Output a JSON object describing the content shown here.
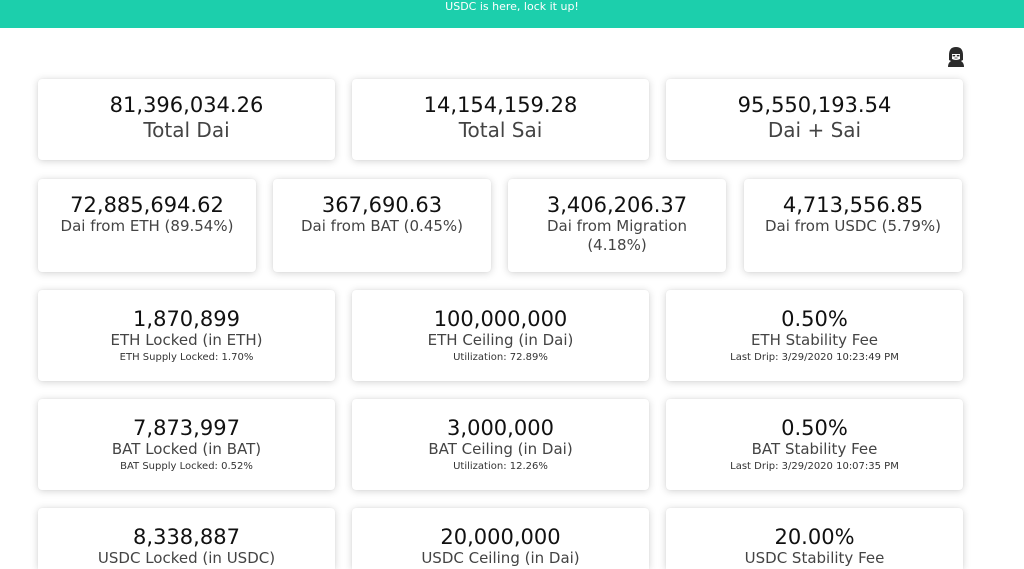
{
  "banner": {
    "text": "USDC is here, lock it up!"
  },
  "totals": [
    {
      "value": "81,396,034.26",
      "label": "Total Dai"
    },
    {
      "value": "14,154,159.28",
      "label": "Total Sai"
    },
    {
      "value": "95,550,193.54",
      "label": "Dai + Sai"
    }
  ],
  "sources": [
    {
      "value": "72,885,694.62",
      "label": "Dai from ETH (89.54%)"
    },
    {
      "value": "367,690.63",
      "label": "Dai from BAT (0.45%)"
    },
    {
      "value": "3,406,206.37",
      "label": "Dai from Migration (4.18%)"
    },
    {
      "value": "4,713,556.85",
      "label": "Dai from USDC (5.79%)"
    }
  ],
  "eth": [
    {
      "value": "1,870,899",
      "label": "ETH Locked (in ETH)",
      "sub": "ETH Supply Locked: 1.70%"
    },
    {
      "value": "100,000,000",
      "label": "ETH Ceiling (in Dai)",
      "sub": "Utilization: 72.89%"
    },
    {
      "value": "0.50%",
      "label": "ETH Stability Fee",
      "sub": "Last Drip: 3/29/2020 10:23:49 PM"
    }
  ],
  "bat": [
    {
      "value": "7,873,997",
      "label": "BAT Locked (in BAT)",
      "sub": "BAT Supply Locked: 0.52%"
    },
    {
      "value": "3,000,000",
      "label": "BAT Ceiling (in Dai)",
      "sub": "Utilization: 12.26%"
    },
    {
      "value": "0.50%",
      "label": "BAT Stability Fee",
      "sub": "Last Drip: 3/29/2020 10:07:35 PM"
    }
  ],
  "usdc": [
    {
      "value": "8,338,887",
      "label": "USDC Locked (in USDC)"
    },
    {
      "value": "20,000,000",
      "label": "USDC Ceiling (in Dai)"
    },
    {
      "value": "20.00%",
      "label": "USDC Stability Fee"
    }
  ]
}
